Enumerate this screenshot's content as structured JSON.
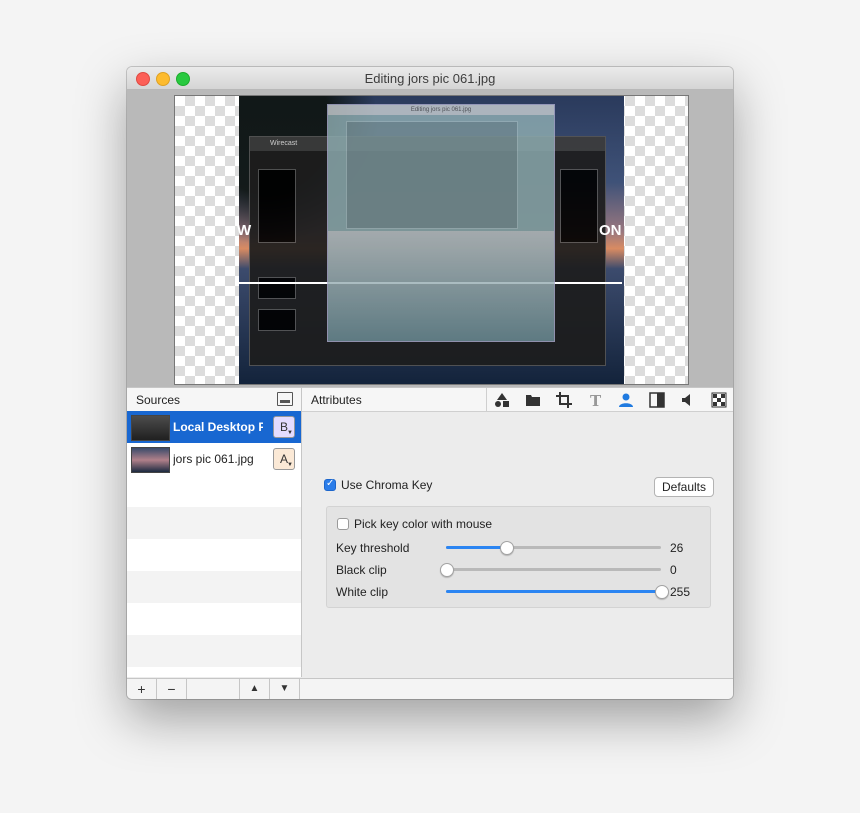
{
  "window": {
    "title": "Editing jors pic 061.jpg"
  },
  "preview": {
    "inner_window_title": "Wirecast",
    "overlay_text_left": "W",
    "overlay_text_right": "ON"
  },
  "sources": {
    "header": "Sources",
    "items": [
      {
        "label": "Local Desktop Presenter",
        "layer": "B",
        "selected": true
      },
      {
        "label": "jors pic 061.jpg",
        "layer": "A",
        "selected": false
      }
    ]
  },
  "bottom_bar": {
    "add": "+",
    "remove": "−",
    "up": "▲",
    "down": "▼"
  },
  "attributes": {
    "header": "Attributes",
    "toolbar_icons": [
      "shapes-icon",
      "folder-icon",
      "crop-icon",
      "text-icon",
      "chroma-key-person-icon",
      "mask-icon",
      "audio-icon",
      "checker-icon"
    ],
    "use_chroma_key": {
      "label": "Use Chroma Key",
      "checked": true
    },
    "defaults_button": "Defaults",
    "pick_key_color": {
      "label": "Pick key color with mouse",
      "checked": false
    },
    "sliders": [
      {
        "label": "Key threshold",
        "value": "26",
        "fraction": 0.28
      },
      {
        "label": "Black clip",
        "value": "0",
        "fraction": 0.0
      },
      {
        "label": "White clip",
        "value": "255",
        "fraction": 1.0
      }
    ]
  },
  "colors": {
    "selection": "#1867d1",
    "accent": "#2b85f2"
  }
}
